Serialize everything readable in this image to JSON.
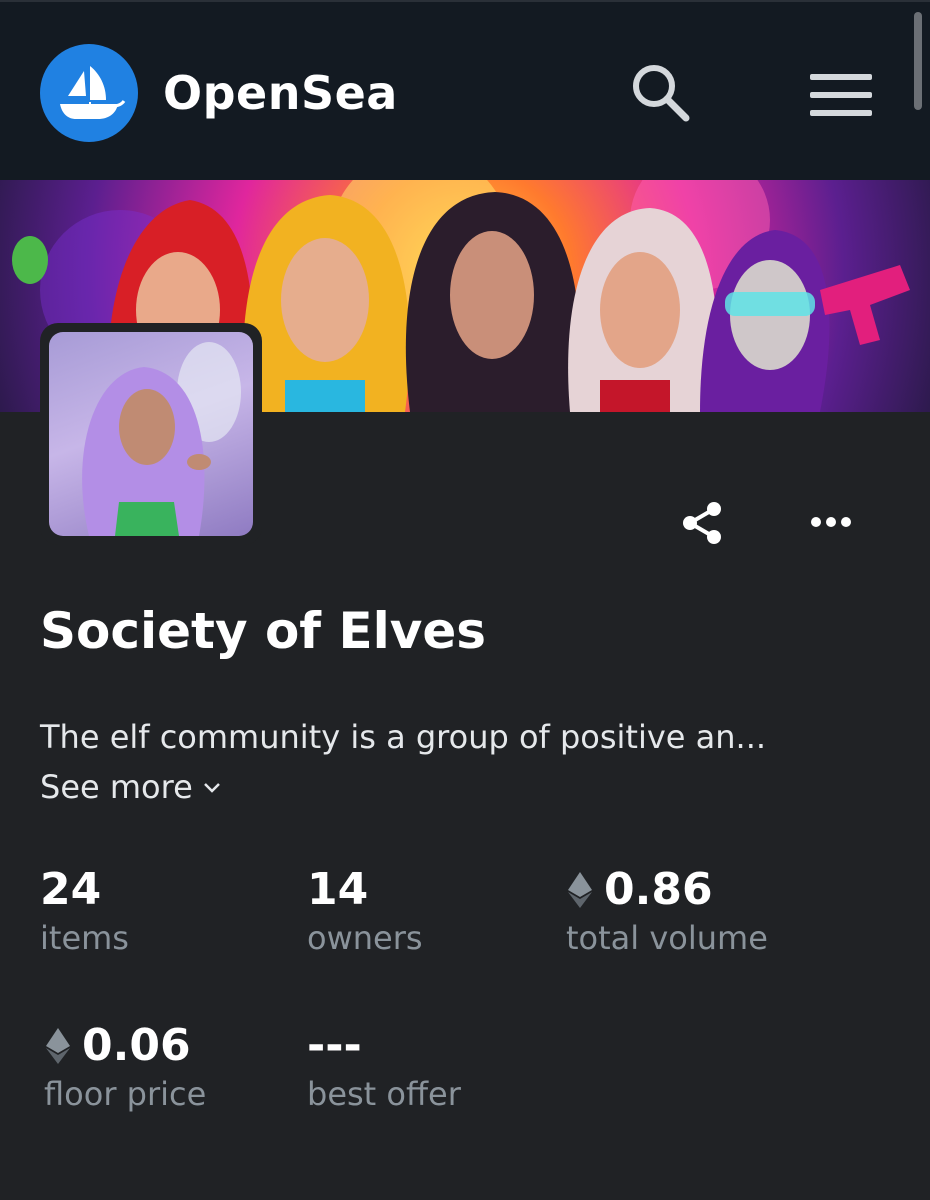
{
  "header": {
    "brand": "OpenSea",
    "search_icon": "search-icon",
    "menu_icon": "hamburger-menu-icon",
    "logo_icon": "sailboat-logo-icon",
    "brand_color": "#2081e2"
  },
  "collection": {
    "name": "Society of Elves",
    "description": "The elf community is a group of positive an...",
    "see_more": "See more",
    "share_icon": "share-icon",
    "more_icon": "more-options-icon"
  },
  "stats": [
    {
      "value": "24",
      "label": "items",
      "currency": ""
    },
    {
      "value": "14",
      "label": "owners",
      "currency": ""
    },
    {
      "value": "0.86",
      "label": "total volume",
      "currency": "eth-icon"
    },
    {
      "value": "0.06",
      "label": "floor price",
      "currency": "eth-icon"
    },
    {
      "value": "---",
      "label": "best offer",
      "currency": ""
    }
  ],
  "colors": {
    "header_bg": "#131a22",
    "page_bg": "#202225",
    "label_gray": "#8a939b"
  }
}
